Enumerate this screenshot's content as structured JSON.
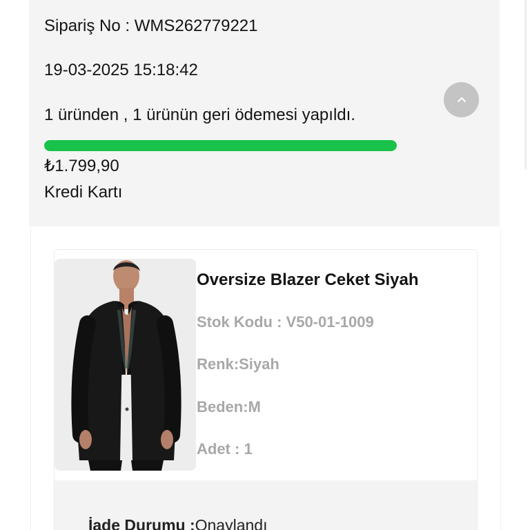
{
  "order": {
    "number_label": "Sipariş No : WMS262779221",
    "date": "19-03-2025 15:18:42",
    "refund_status": "1 üründen , 1 ürünün geri ödemesi yapıldı.",
    "refund_progress_fraction": 1.0,
    "amount": "₺1.799,90",
    "payment_method": "Kredi Kartı",
    "collapse_icon": "chevron-up-icon",
    "accent_color": "#19c24a"
  },
  "product": {
    "title": "Oversize Blazer Ceket Siyah",
    "stock_code": "Stok Kodu : V50-01-1009",
    "color": "Renk:Siyah",
    "size": "Beden:M",
    "quantity": "Adet : 1",
    "image_icon": "product-photo"
  },
  "return": {
    "status_label": "İade Durumu :",
    "status_value": "Onaylandı"
  }
}
